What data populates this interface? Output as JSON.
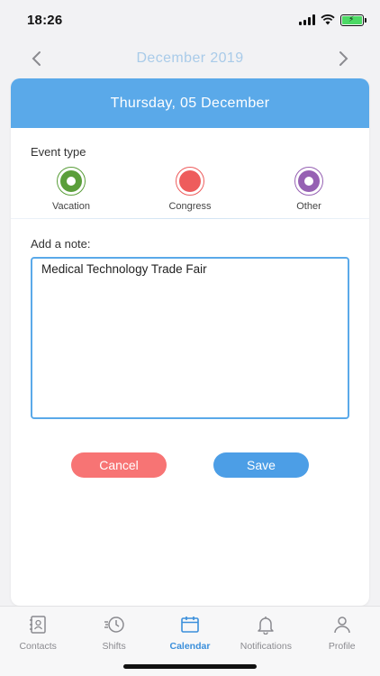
{
  "status_bar": {
    "time": "18:26"
  },
  "month_nav": {
    "title": "December 2019",
    "prev_icon": "chevron-left-icon",
    "next_icon": "chevron-right-icon"
  },
  "card": {
    "date_title": "Thursday, 05 December",
    "event_type_label": "Event type",
    "event_options": [
      {
        "label": "Vacation",
        "color": "#5a9e3a",
        "selected": true
      },
      {
        "label": "Congress",
        "color": "#ee5c5c",
        "selected": false
      },
      {
        "label": "Other",
        "color": "#9661b3",
        "selected": false
      }
    ],
    "note_label": "Add a note:",
    "note_value": "Medical Technology Trade Fair",
    "cancel_label": "Cancel",
    "save_label": "Save"
  },
  "tabs": [
    {
      "label": "Contacts",
      "icon": "contacts-book-icon",
      "active": false
    },
    {
      "label": "Shifts",
      "icon": "history-clock-icon",
      "active": false
    },
    {
      "label": "Calendar",
      "icon": "calendar-icon",
      "active": true
    },
    {
      "label": "Notifications",
      "icon": "bell-icon",
      "active": false
    },
    {
      "label": "Profile",
      "icon": "person-icon",
      "active": false
    }
  ],
  "colors": {
    "accent": "#5aa9e9",
    "cancel": "#f77474",
    "save": "#4c9ee6",
    "active_tab": "#3b8fdb"
  }
}
